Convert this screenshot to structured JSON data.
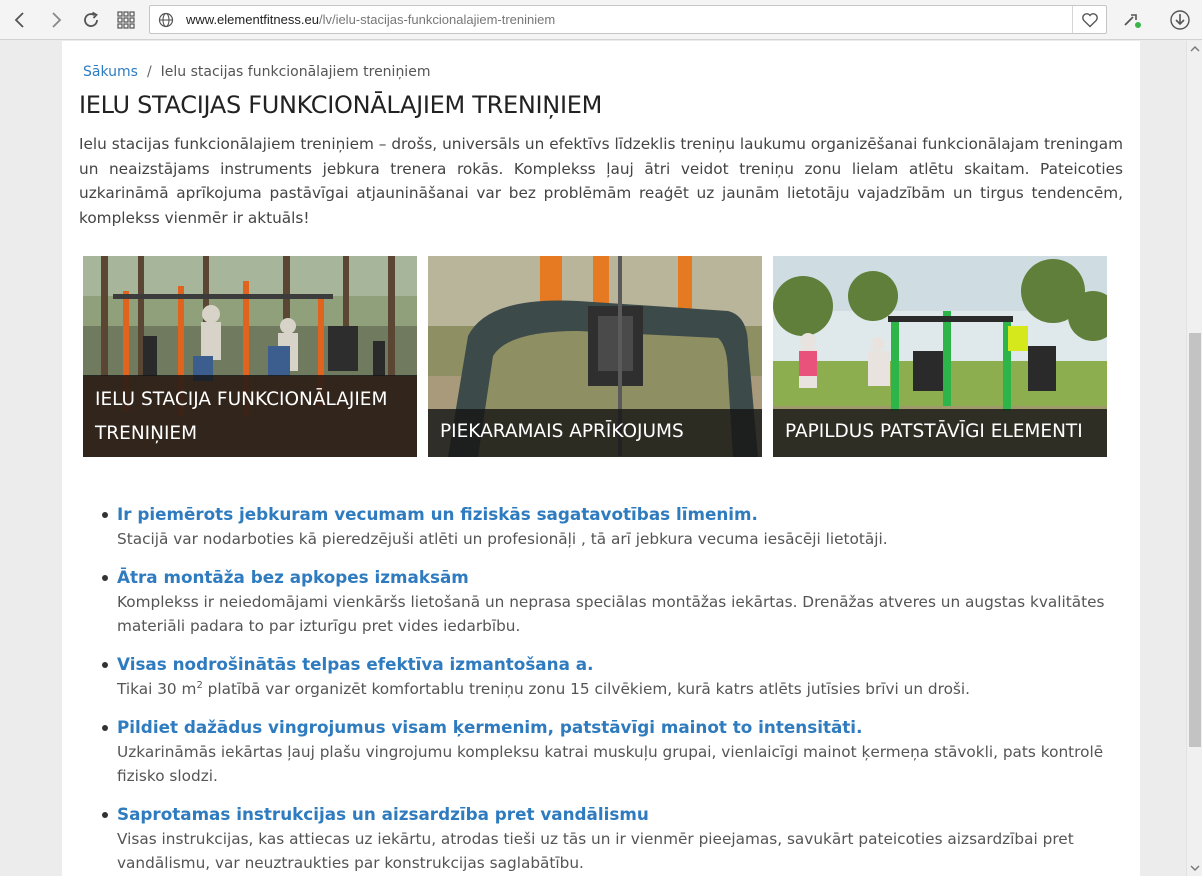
{
  "browser": {
    "url_host": "www.elementfitness.eu",
    "url_path": "/lv/ielu-stacijas-funkcionalajiem-treniniem"
  },
  "breadcrumb": {
    "home": "Sākums",
    "separator": "/",
    "current": "Ielu stacijas funkcionālajiem treniņiem"
  },
  "page": {
    "title": "IELU STACIJAS FUNKCIONĀLAJIEM TRENIŅIEM",
    "intro": "Ielu stacijas funkcionālajiem treniņiem – drošs, universāls un efektīvs līdzeklis treniņu laukumu organizēšanai funkcionālajam treningam un neaizstājams instruments jebkura trenera rokās.  Komplekss ļauj ātri veidot treniņu zonu lielam atlētu skaitam. Pateicoties uzkarināmā aprīkojuma pastāvīgai atjaunināšanai  var bez problēmām reaģēt  uz jaunām lietotāju vajadzībām un tirgus tendencēm, komplekss vienmēr ir aktuāls!"
  },
  "tiles": [
    {
      "caption": "IELU STACIJA FUNKCIONĀLAJIEM TRENIŅIEM"
    },
    {
      "caption": "PIEKARAMAIS APRĪKOJUMS"
    },
    {
      "caption": "PAPILDUS PATSTĀVĪGI ELEMENTI"
    }
  ],
  "features": [
    {
      "title": "Ir piemērots jebkuram vecumam un  fiziskās sagatavotības līmenim.",
      "desc": "Stacijā var nodarboties kā pieredzējuši atlēti un profesionāļi , tā arī  jebkura vecuma iesācēji lietotāji."
    },
    {
      "title": "Ātra montāža bez apkopes izmaksām",
      "desc": "Komplekss ir neiedomājami vienkāršs lietošanā un neprasa speciālas  montāžas iekārtas. Drenāžas atveres un augstas kvalitātes materiāli  padara to par izturīgu pret vides iedarbību."
    },
    {
      "title": "Visas nodrošinātās telpas efektīva izmantošana a.",
      "desc_before": "Tikai 30 m",
      "desc_sup": "2",
      "desc_after": " platībā var organizēt  komfortablu treniņu zonu 15 cilvēkiem, kurā katrs atlēts jutīsies brīvi un droši."
    },
    {
      "title": "Pildiet dažādus vingrojumus visam ķermenim, patstāvīgi mainot to intensitāti.",
      "desc": "Uzkarināmās iekārtas ļauj plašu vingrojumu kompleksu  katrai muskuļu grupai, vienlaicīgi  mainot  ķermeņa stāvokli, pats kontrolē fizisko slodzi."
    },
    {
      "title": "Saprotamas instrukcijas un aizsardzība pret vandālismu",
      "desc": "Visas instrukcijas, kas attiecas uz iekārtu, atrodas tieši uz tās un ir vienmēr pieejamas, savukārt pateicoties aizsardzībai pret vandālismu, var neuztraukties par konstrukcijas saglabātību."
    }
  ],
  "colors": {
    "link": "#2f7bbf",
    "caption_bg": "#161616"
  },
  "icons": [
    "back-icon",
    "forward-icon",
    "reload-icon",
    "apps-grid-icon",
    "globe-icon",
    "heart-icon",
    "extension-icon",
    "download-icon"
  ]
}
